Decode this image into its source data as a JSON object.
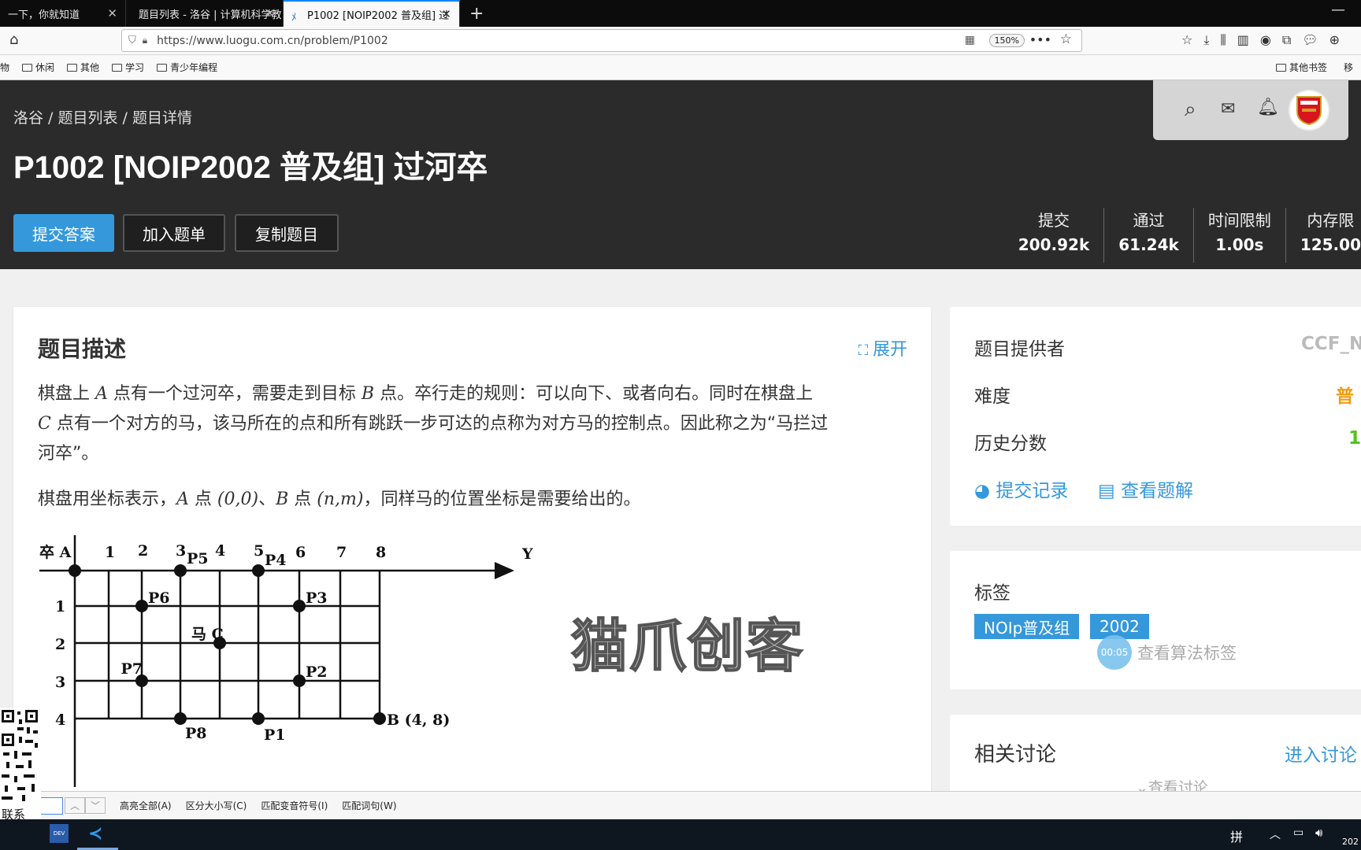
{
  "browser": {
    "tabs": [
      {
        "label": "一下，你就知道"
      },
      {
        "label": "题目列表 - 洛谷 | 计算机科学教"
      },
      {
        "label": "P1002 [NOIP2002 普及组] 过"
      }
    ],
    "url": "https://www.luogu.com.cn/problem/P1002",
    "zoom": "150%",
    "bookmarks_left": [
      "购物",
      "休闲",
      "其他",
      "学习",
      "青少年编程"
    ],
    "bookmarks_right": [
      "其他书签",
      "移"
    ]
  },
  "header": {
    "breadcrumb": "洛谷 / 题目列表 / 题目详情",
    "title": "P1002 [NOIP2002 普及组] 过河卒",
    "buttons": {
      "submit": "提交答案",
      "add_list": "加入题单",
      "copy": "复制题目"
    },
    "stats": [
      {
        "label": "提交",
        "value": "200.92k"
      },
      {
        "label": "通过",
        "value": "61.24k"
      },
      {
        "label": "时间限制",
        "value": "1.00s"
      },
      {
        "label": "内存限",
        "value": "125.00"
      }
    ]
  },
  "problem": {
    "heading": "题目描述",
    "expand": "展开",
    "p1a": "棋盘上",
    "p1b": "点有一个过河卒，需要走到目标",
    "p1c": "点。卒行走的规则：可以向下、或者向右。同时在棋盘上",
    "p1d": "点有一个对方的马，该马所在的点和所有跳跃一步可达的点称为对方马的控制点。因此称之为“马拦过",
    "p1e": "河卒”。",
    "A": "A",
    "B": "B",
    "C": "C",
    "p2a": "棋盘用坐标表示，",
    "p2b": "点",
    "p2c": "、",
    "p2d": "点",
    "p2e": "，同样马的位置坐标是需要给出的。",
    "coordA": "(0,0)",
    "coordB": "(n,m)"
  },
  "diagram": {
    "pawn": "卒 A",
    "cols": [
      "1",
      "2",
      "3",
      "4",
      "5",
      "6",
      "7",
      "8"
    ],
    "rows": [
      "1",
      "2",
      "3",
      "4"
    ],
    "axis_y": "Y",
    "labels": {
      "P1": "P1",
      "P2": "P2",
      "P3": "P3",
      "P4": "P4",
      "P5": "P5",
      "P6": "P6",
      "P7": "P7",
      "P8": "P8",
      "horse": "马 C",
      "target": "B (4, 8)"
    }
  },
  "watermark": "猫爪创客",
  "sidebar": {
    "provider_label": "题目提供者",
    "provider_value": "CCF_N",
    "difficulty_label": "难度",
    "difficulty_value": "普",
    "history_label": "历史分数",
    "history_value": "1",
    "submit_records": "提交记录",
    "view_solution": "查看题解",
    "tags_heading": "标签",
    "tags": [
      "NOIp普及组",
      "2002"
    ],
    "algo_tags": "查看算法标签",
    "timer": "00:05",
    "discuss_heading": "相关讨论",
    "discuss_link": "进入讨论",
    "view_discuss": "查看讨论"
  },
  "findbar": {
    "items": [
      "高亮全部(A)",
      "区分大小写(C)",
      "匹配变音符号(I)",
      "匹配词句(W)"
    ]
  },
  "overlay": {
    "contact": "联系"
  },
  "taskbar": {
    "ime": "拼",
    "dev_label": "DEV",
    "year": "202"
  }
}
